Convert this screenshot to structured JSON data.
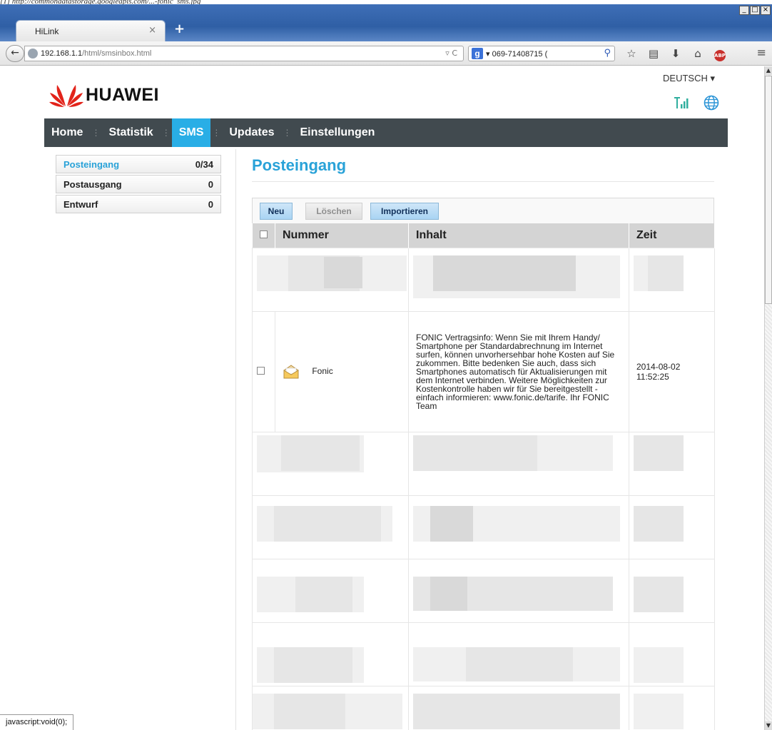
{
  "crop_strip_text": "[1] http://commondatastorage.googleapis.com/...-fonic_sms.jpg",
  "browser": {
    "tab_title": "HiLink",
    "tab_close": "×",
    "new_tab": "+",
    "url_host": "192.168.1.1",
    "url_path": "/html/smsinbox.html",
    "search_text": "069-71408715 (",
    "back_icon": "←",
    "status_text": "javascript:void(0);"
  },
  "header": {
    "brand": "HUAWEI",
    "language": "DEUTSCH ▾"
  },
  "nav": {
    "items": [
      "Home",
      "Statistik",
      "SMS",
      "Updates",
      "Einstellungen"
    ],
    "active": "SMS"
  },
  "sidebar": {
    "items": [
      {
        "label": "Posteingang",
        "count": "0/34"
      },
      {
        "label": "Postausgang",
        "count": "0"
      },
      {
        "label": "Entwurf",
        "count": "0"
      }
    ]
  },
  "main": {
    "title": "Posteingang",
    "toolbar": {
      "new": "Neu",
      "delete": "Löschen",
      "import": "Importieren"
    },
    "columns": {
      "number": "Nummer",
      "content": "Inhalt",
      "time": "Zeit"
    },
    "message": {
      "sender": "Fonic",
      "content": "FONIC Vertragsinfo: Wenn Sie mit Ihrem Handy/ Smartphone per Standardabrechnung im Internet surfen, können unvorhersehbar hohe Kosten auf Sie zukommen. Bitte bedenken Sie auch, dass sich Smartphones automatisch für Aktualisierungen mit dem Internet verbinden. Weitere Möglichkeiten zur Kostenkontrolle haben wir für Sie bereitgestellt - einfach informieren: www.fonic.de/tarife. Ihr FONIC Team",
      "date": "2014-08-02",
      "time": "11:52:25"
    }
  },
  "colors": {
    "accent": "#29a2d8",
    "nav_bg": "#414a4f",
    "active_tab": "#29aee6"
  }
}
